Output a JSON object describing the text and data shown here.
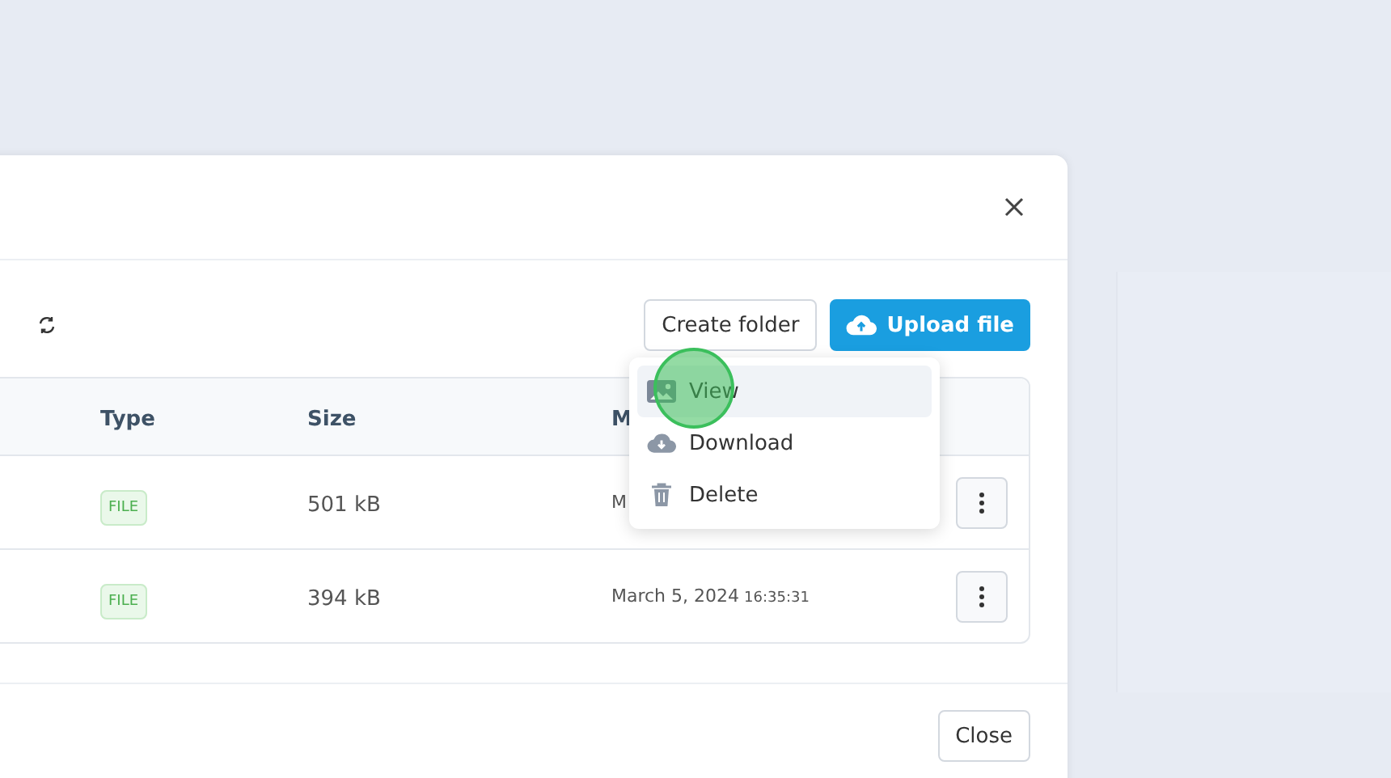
{
  "toolbar": {
    "buttons": [
      {
        "kind": "outline",
        "label": "Create folder"
      },
      {
        "kind": "upload",
        "label": "Upload file"
      }
    ]
  },
  "table": {
    "columns": [
      "Type",
      "Size",
      "M"
    ],
    "rows": [
      {
        "type": "FILE",
        "size": "501 kB",
        "modified": "M",
        "time": ""
      },
      {
        "type": "FILE",
        "size": "394 kB",
        "modified": "March 5, 2024",
        "time": "16:35:31"
      }
    ]
  },
  "menu": {
    "items": [
      {
        "kind": "view",
        "label": "View",
        "selected": true
      },
      {
        "kind": "download",
        "label": "Download",
        "selected": false
      },
      {
        "kind": "delete",
        "label": "Delete",
        "selected": false
      }
    ]
  },
  "footer": {
    "button": "Close"
  }
}
